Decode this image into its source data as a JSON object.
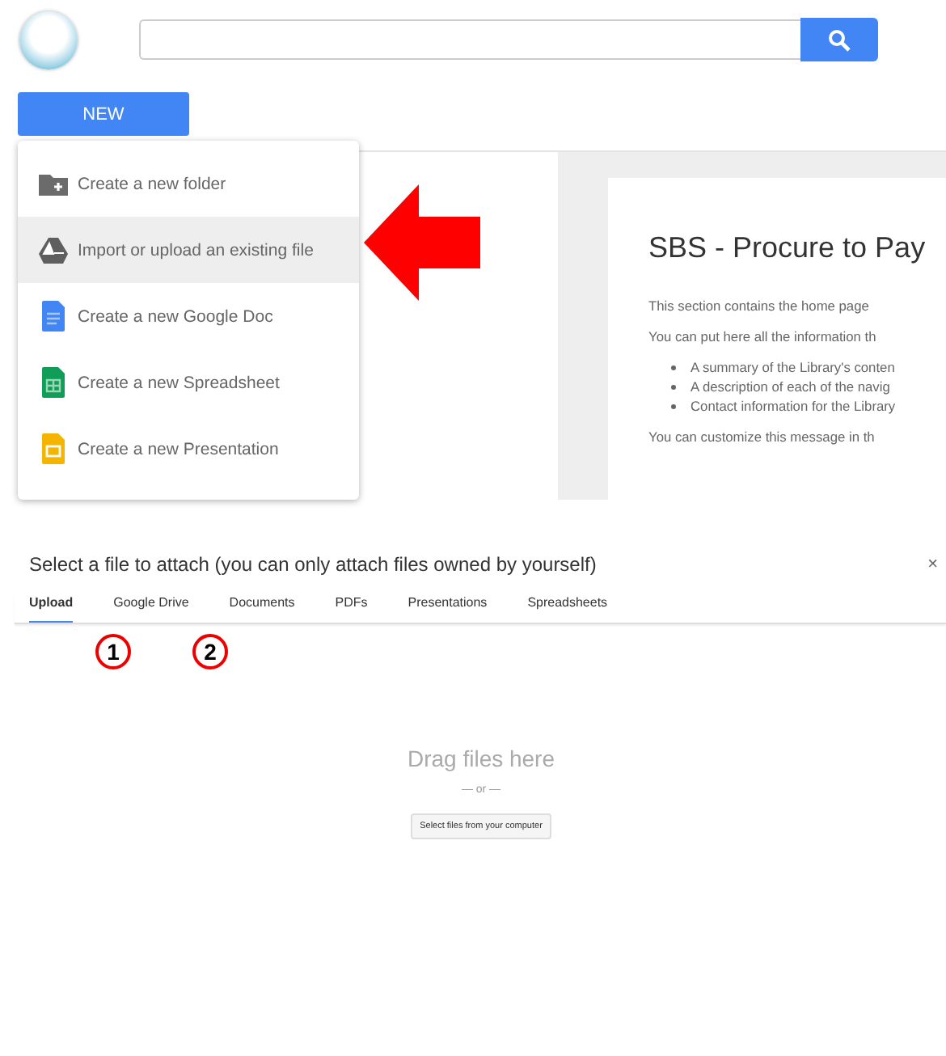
{
  "new_button": {
    "label": "NEW"
  },
  "new_menu": {
    "items": [
      {
        "label": "Create a new folder",
        "kind": "folder",
        "selected": false
      },
      {
        "label": "Import or upload an existing file",
        "kind": "drive",
        "selected": true
      },
      {
        "label": "Create a new Google Doc",
        "kind": "doc",
        "selected": false
      },
      {
        "label": "Create a new Spreadsheet",
        "kind": "sheet",
        "selected": false
      },
      {
        "label": "Create a new Presentation",
        "kind": "slides",
        "selected": false
      }
    ]
  },
  "home_card": {
    "title": "SBS - Procure to Pay",
    "paragraphs": [
      "This section contains the home page",
      "You can put here all the information th"
    ],
    "bullets": [
      "A summary of the Library's conten",
      "A description of each of the navig",
      "Contact information for the Library"
    ],
    "footer": "You can customize this message in th"
  },
  "dialog": {
    "title": "Select a file to attach (you can only attach files owned by yourself)",
    "close": "×",
    "tabs": [
      {
        "label": "Upload",
        "selected": true
      },
      {
        "label": "Google Drive",
        "selected": false
      },
      {
        "label": "Documents",
        "selected": false
      },
      {
        "label": "PDFs",
        "selected": false
      },
      {
        "label": "Presentations",
        "selected": false
      },
      {
        "label": "Spreadsheets",
        "selected": false
      }
    ],
    "markers": [
      {
        "label": "1"
      },
      {
        "label": "2"
      }
    ],
    "drop_text": "Drag files here",
    "or_text": "— or —",
    "select_button": "Select files from your computer"
  }
}
